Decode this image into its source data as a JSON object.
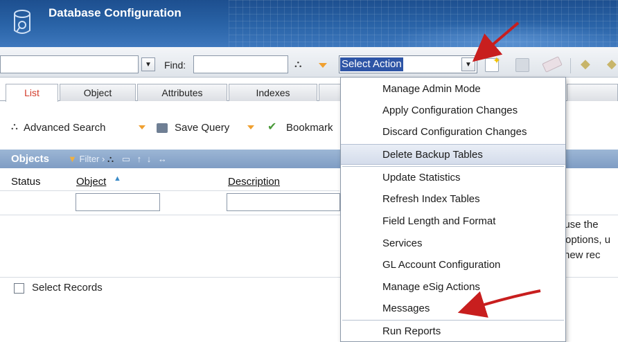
{
  "header": {
    "title": "Database Configuration"
  },
  "toolbar": {
    "find_label": "Find:",
    "find_value": "",
    "query_value": "",
    "action_select_value": "Select Action"
  },
  "tabs": [
    {
      "label": "List",
      "active": true
    },
    {
      "label": "Object"
    },
    {
      "label": "Attributes"
    },
    {
      "label": "Indexes"
    },
    {
      "label": ""
    }
  ],
  "search_bar": {
    "advanced_search": "Advanced Search",
    "save_query": "Save Query",
    "bookmarks": "Bookmark"
  },
  "objects_grid": {
    "title": "Objects",
    "filter_label": "Filter",
    "columns": [
      {
        "label": "Status"
      },
      {
        "label": "Object"
      },
      {
        "label": "Description"
      }
    ]
  },
  "message_fragments": [
    ", use the",
    "options, u",
    "new rec"
  ],
  "select_records_label": "Select Records",
  "action_menu": {
    "items": [
      {
        "label": "Manage Admin Mode"
      },
      {
        "label": "Apply Configuration Changes"
      },
      {
        "label": "Discard Configuration Changes"
      },
      {
        "label": "Delete Backup Tables",
        "highlighted": true
      },
      {
        "label": "Update Statistics"
      },
      {
        "label": "Refresh Index Tables"
      },
      {
        "label": "Field Length and Format"
      },
      {
        "label": "Services"
      },
      {
        "label": "GL Account Configuration"
      },
      {
        "label": "Manage eSig Actions"
      },
      {
        "label": "Messages"
      },
      {
        "label": "Run Reports"
      }
    ]
  },
  "colors": {
    "header_blue": "#2a64a8",
    "active_tab_text": "#d23a2a",
    "selection_blue": "#2e55a6",
    "annotation_arrow": "#c81e1e"
  },
  "icons": [
    "database-gear-icon",
    "binoculars-icon",
    "new-record-icon",
    "save-icon",
    "clear-icon",
    "previous-icon",
    "next-icon",
    "check-icon"
  ]
}
